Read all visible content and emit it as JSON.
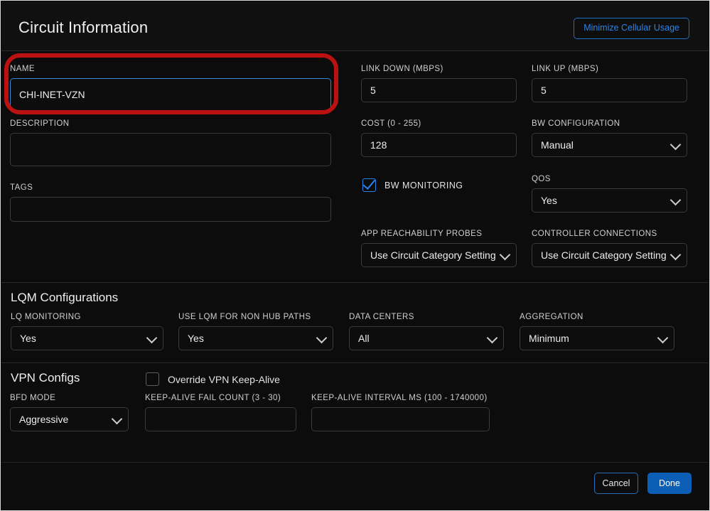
{
  "header": {
    "title": "Circuit Information",
    "minimize_button": "Minimize Cellular Usage"
  },
  "circuit": {
    "name_label": "NAME",
    "name_value": "CHI-INET-VZN",
    "description_label": "DESCRIPTION",
    "description_value": "",
    "tags_label": "TAGS",
    "tags_value": "",
    "link_down_label": "LINK DOWN (Mbps)",
    "link_down_value": "5",
    "link_up_label": "LINK UP (Mbps)",
    "link_up_value": "5",
    "cost_label": "COST (0 - 255)",
    "cost_value": "128",
    "bw_configuration_label": "BW CONFIGURATION",
    "bw_configuration_value": "Manual",
    "bw_monitoring_label": "BW MONITORING",
    "bw_monitoring_checked": true,
    "qos_label": "QOS",
    "qos_value": "Yes",
    "app_reachability_label": "APP REACHABILITY PROBES",
    "app_reachability_value": "Use Circuit Category Setting",
    "controller_connections_label": "CONTROLLER CONNECTIONS",
    "controller_connections_value": "Use Circuit Category Setting"
  },
  "lqm": {
    "section_title": "LQM Configurations",
    "lq_monitoring_label": "LQ MONITORING",
    "lq_monitoring_value": "Yes",
    "use_lqm_non_hub_label": "USE LQM FOR NON HUB PATHS",
    "use_lqm_non_hub_value": "Yes",
    "data_centers_label": "DATA CENTERS",
    "data_centers_value": "All",
    "aggregation_label": "AGGREGATION",
    "aggregation_value": "Minimum"
  },
  "vpn": {
    "section_title": "VPN Configs",
    "override_keepalive_label": "Override VPN Keep-Alive",
    "override_keepalive_checked": false,
    "bfd_mode_label": "BFD MODE",
    "bfd_mode_value": "Aggressive",
    "fail_count_label": "KEEP-ALIVE FAIL COUNT (3 - 30)",
    "fail_count_value": "",
    "interval_label": "KEEP-ALIVE INTERVAL MS (100 - 1740000)",
    "interval_value": ""
  },
  "footer": {
    "cancel_label": "Cancel",
    "done_label": "Done"
  },
  "colors": {
    "accent_blue": "#2b85e8",
    "primary_button": "#0d5fb5",
    "annotation_red": "#bb1111",
    "panel_background": "#0c0c0c"
  }
}
